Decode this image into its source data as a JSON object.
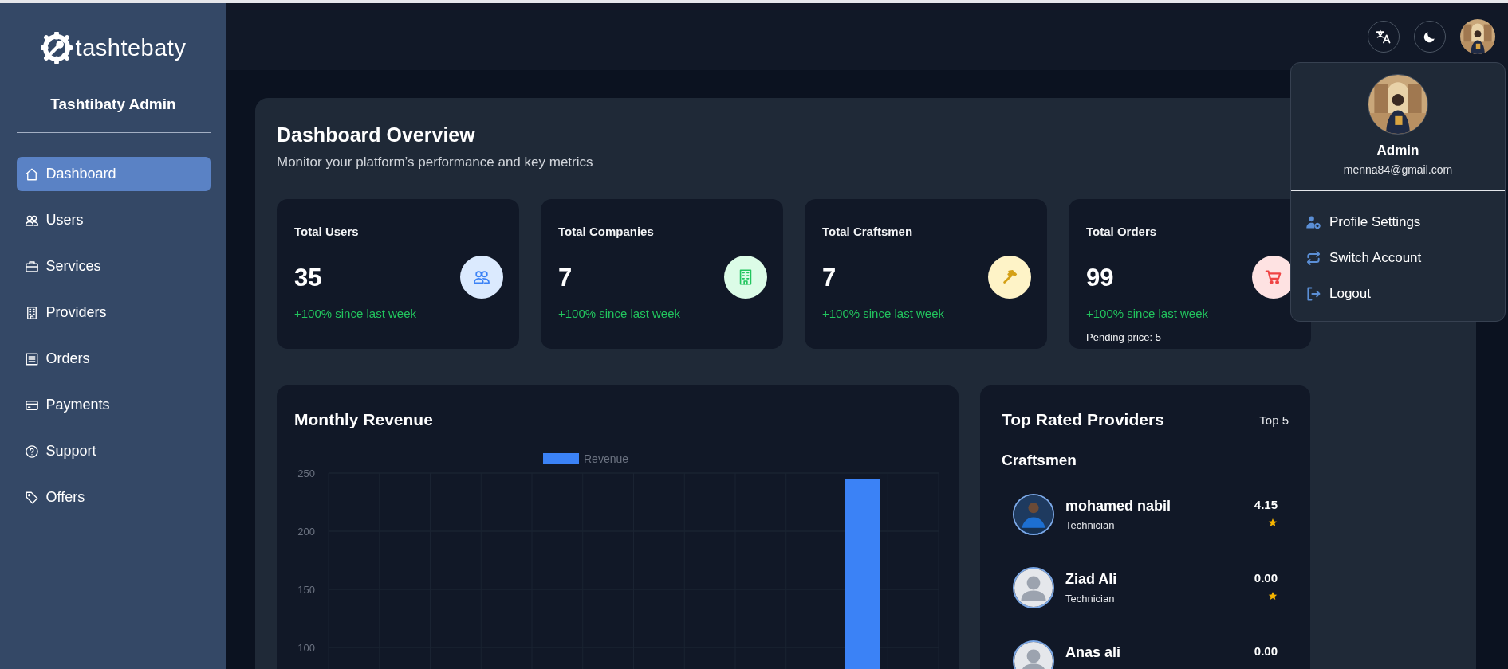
{
  "brand": {
    "name": "tashtebaty",
    "subtitle": "Tashtibaty Admin"
  },
  "sidebar": {
    "items": [
      {
        "kind": "home",
        "label": "Dashboard",
        "selected": true
      },
      {
        "kind": "users",
        "label": "Users",
        "selected": false
      },
      {
        "kind": "briefcase",
        "label": "Services",
        "selected": false
      },
      {
        "kind": "building",
        "label": "Providers",
        "selected": false
      },
      {
        "kind": "receipt",
        "label": "Orders",
        "selected": false
      },
      {
        "kind": "card",
        "label": "Payments",
        "selected": false
      },
      {
        "kind": "help",
        "label": "Support",
        "selected": false
      },
      {
        "kind": "tag",
        "label": "Offers",
        "selected": false
      }
    ]
  },
  "account_menu": {
    "name": "Admin",
    "email": "menna84@gmail.com",
    "items": [
      {
        "kind": "profile",
        "label": "Profile Settings"
      },
      {
        "kind": "switch",
        "label": "Switch Account"
      },
      {
        "kind": "logout",
        "label": "Logout"
      }
    ]
  },
  "overview": {
    "title": "Dashboard Overview",
    "subtitle": "Monitor your platform’s performance and key metrics",
    "stats": [
      {
        "kind": "users",
        "label": "Total Users",
        "value": "35",
        "change": "+100% since last week",
        "color": "#dbeafe"
      },
      {
        "kind": "building",
        "label": "Total Companies",
        "value": "7",
        "change": "+100% since last week",
        "color": "#dcfce7"
      },
      {
        "kind": "hammer",
        "label": "Total Craftsmen",
        "value": "7",
        "change": "+100% since last week",
        "color": "#fef3c7"
      },
      {
        "kind": "cart",
        "label": "Total Orders",
        "value": "99",
        "change": "+100% since last week",
        "note": "Pending price: 5",
        "color": "#fee2e2"
      }
    ]
  },
  "revenue": {
    "title": "Monthly Revenue",
    "chart_data": {
      "type": "bar",
      "series": [
        {
          "name": "Revenue",
          "color": "#3b82f6",
          "values": [
            null,
            null,
            null,
            null,
            null,
            null,
            null,
            null,
            null,
            null,
            245,
            null
          ]
        }
      ],
      "ylim": [
        0,
        250
      ],
      "yticks": [
        100,
        150,
        200,
        250
      ],
      "grid": true
    }
  },
  "providers": {
    "title": "Top Rated Providers",
    "badge": "Top 5",
    "section": "Craftsmen",
    "items": [
      {
        "name": "mohamed nabil",
        "role": "Technician",
        "rating": "4.15"
      },
      {
        "kind": "placeholder",
        "name": "Ziad Ali",
        "role": "Technician",
        "rating": "0.00"
      },
      {
        "kind": "placeholder",
        "name": "Anas ali",
        "rating": "0.00"
      }
    ]
  }
}
